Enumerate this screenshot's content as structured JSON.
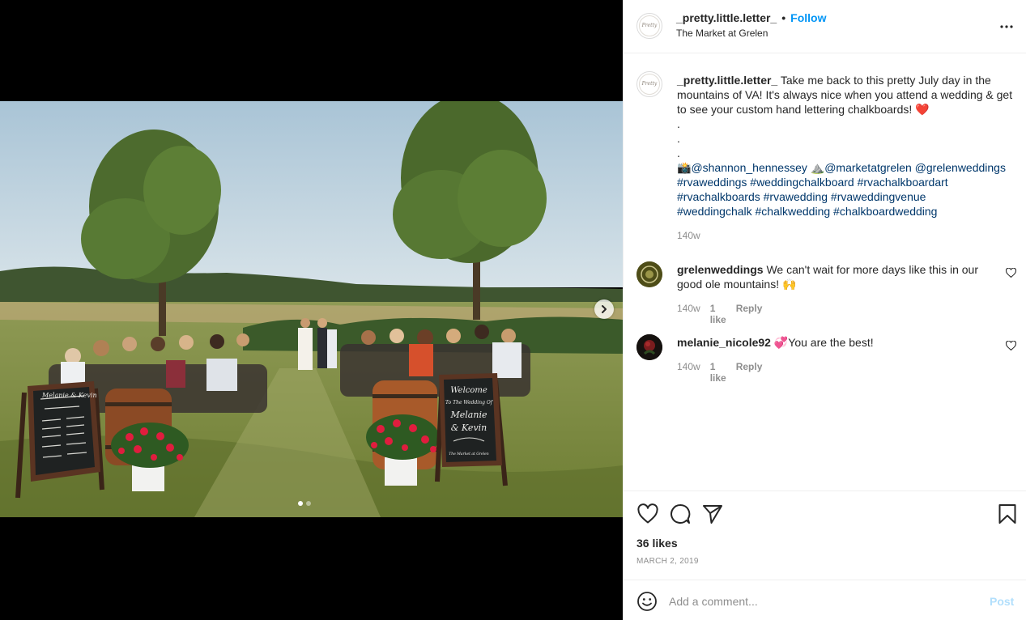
{
  "media": {
    "description_icon": "wedding-photo",
    "carousel": {
      "total": 2,
      "active": 0
    },
    "sign_left_title": "Melanie & Kevin",
    "sign_right_lines": [
      "Welcome",
      "To The Wedding Of",
      "Melanie",
      "& Kevin",
      "The Market at Grelen"
    ]
  },
  "header": {
    "username": "_pretty.little.letter_",
    "separator": "•",
    "follow_label": "Follow",
    "location": "The Market at Grelen",
    "avatar_text": "Pretty"
  },
  "caption": {
    "username": "_pretty.little.letter_",
    "text": "Take me back to this pretty July day in the mountains of VA! It's always nice when you attend a wedding & get to see your custom hand lettering chalkboards! ❤️",
    "dots": [
      ".",
      ".",
      "."
    ],
    "camera_emoji": "📸",
    "mention1": "@shannon_hennessey",
    "mountain_emoji": "⛰️",
    "mention2": "@marketatgrelen",
    "mention3": "@grelenweddings",
    "tags": [
      "#rvaweddings",
      "#weddingchalkboard",
      "#rvachalkboardart",
      "#rvachalkboards",
      "#rvawedding",
      "#rvaweddingvenue",
      "#weddingchalk",
      "#chalkwedding",
      "#chalkboardwedding"
    ],
    "time": "140w"
  },
  "comments": [
    {
      "username": "grelenweddings",
      "text": "We can't wait for more days like this in our good ole mountains! 🙌",
      "time": "140w",
      "likes": "1 like",
      "reply": "Reply"
    },
    {
      "username": "melanie_nicole92",
      "emoji": "💞",
      "text": "You are the best!",
      "time": "140w",
      "likes": "1 like",
      "reply": "Reply"
    }
  ],
  "footer": {
    "likes": "36 likes",
    "date": "MARCH 2, 2019",
    "comment_placeholder": "Add a comment...",
    "post_label": "Post"
  },
  "colors": {
    "link_blue": "#0095f6",
    "hashtag": "#00376b",
    "meta_gray": "#8e8e8e",
    "post_disabled": "#b2dffc"
  }
}
